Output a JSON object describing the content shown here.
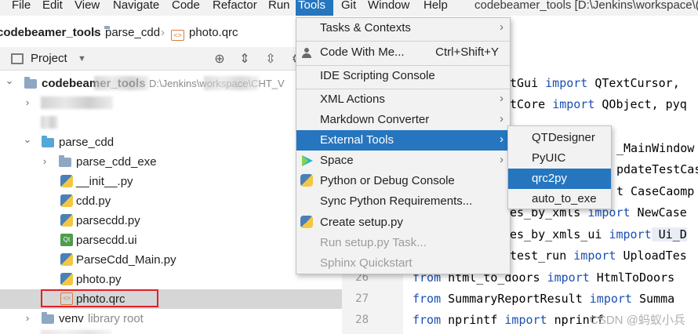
{
  "menubar": {
    "items": [
      "File",
      "Edit",
      "View",
      "Navigate",
      "Code",
      "Refactor",
      "Run",
      "Tools",
      "Git",
      "Window",
      "Help"
    ],
    "active": "Tools",
    "window_title": "codebeamer_tools [D:\\Jenkins\\workspace\\("
  },
  "breadcrumb": {
    "items": [
      "codebeamer_tools",
      "parse_cdd",
      "photo.qrc"
    ]
  },
  "project_panel": {
    "title": "Project",
    "tree": {
      "root_label": "codebeamer_tools",
      "root_path_hint": "D:\\Jenkins\\workspace\\CHT_V",
      "folder_parse_cdd": "parse_cdd",
      "folder_parse_cdd_exe": "parse_cdd_exe",
      "files": [
        "__init__.py",
        "cdd.py",
        "parsecdd.py",
        "parsecdd.ui",
        "ParseCdd_Main.py",
        "photo.py",
        "photo.qrc"
      ],
      "venv_label": "venv",
      "venv_hint": "library root"
    }
  },
  "tools_menu": {
    "items": [
      {
        "label": "Tasks & Contexts",
        "shortcut": "",
        "arrow": "›"
      },
      {
        "label": "Code With Me...",
        "shortcut": "Ctrl+Shift+Y",
        "arrow": ""
      },
      {
        "label": "IDE Scripting Console",
        "shortcut": "",
        "arrow": ""
      },
      {
        "label": "XML Actions",
        "shortcut": "",
        "arrow": "›"
      },
      {
        "label": "Markdown Converter",
        "shortcut": "",
        "arrow": "›"
      },
      {
        "label": "External Tools",
        "shortcut": "",
        "arrow": "›"
      },
      {
        "label": "Space",
        "shortcut": "",
        "arrow": "›"
      },
      {
        "label": "Python or Debug Console",
        "shortcut": "",
        "arrow": ""
      },
      {
        "label": "Sync Python Requirements...",
        "shortcut": "",
        "arrow": ""
      },
      {
        "label": "Create setup.py",
        "shortcut": "",
        "arrow": ""
      },
      {
        "label": "Run setup.py Task...",
        "shortcut": "",
        "arrow": ""
      },
      {
        "label": "Sphinx Quickstart",
        "shortcut": "",
        "arrow": ""
      }
    ]
  },
  "external_tools_submenu": {
    "items": [
      "QTDesigner",
      "PyUIC",
      "qrc2py",
      "auto_to_exe"
    ]
  },
  "editor": {
    "visible_line_numbers": [
      "26",
      "27",
      "28"
    ],
    "lines": [
      {
        "a": "tGui ",
        "k1": "import",
        "b": " QTextCursor,",
        "k2": "",
        "c": ""
      },
      {
        "a": "tCore ",
        "k1": "import",
        "b": " QObject, pyq",
        "k2": "",
        "c": ""
      },
      {
        "a": "",
        "k1": "",
        "b": "",
        "k2": "",
        "c": ""
      },
      {
        "a": "",
        "k1": "",
        "b": "_MainWindow",
        "k2": "",
        "c": ""
      },
      {
        "a": "",
        "k1": "",
        "b": "pdateTestCas",
        "k2": "",
        "c": ""
      },
      {
        "a": "",
        "k1": "",
        "b": "t CaseCaomp",
        "k2": "",
        "c": ""
      },
      {
        "a": "es_by_xmls ",
        "k1": "import",
        "b": " NewCase",
        "k2": "",
        "c": ""
      },
      {
        "a": "es_by_xmls_ui ",
        "k1": "import",
        "b": " Ui_D",
        "k2": "",
        "c": ""
      },
      {
        "a": "test_run ",
        "k1": "import",
        "b": " UploadTes",
        "k2": "",
        "c": ""
      },
      {
        "a": "",
        "k1": "from",
        "b": " html_to_doors ",
        "k2": "import",
        "c": " HtmlToDoors"
      },
      {
        "a": "",
        "k1": "from",
        "b": " SummaryReportResult ",
        "k2": "import",
        "c": " Summa"
      },
      {
        "a": "",
        "k1": "from",
        "b": " nprintf ",
        "k2": "import",
        "c": " nprintf"
      }
    ],
    "watermark": "CSDN @蚂蚁小兵"
  },
  "colors": {
    "accent": "#2675bf",
    "keyword": "#1b4fb2",
    "highlight_box": "#e0202a"
  }
}
